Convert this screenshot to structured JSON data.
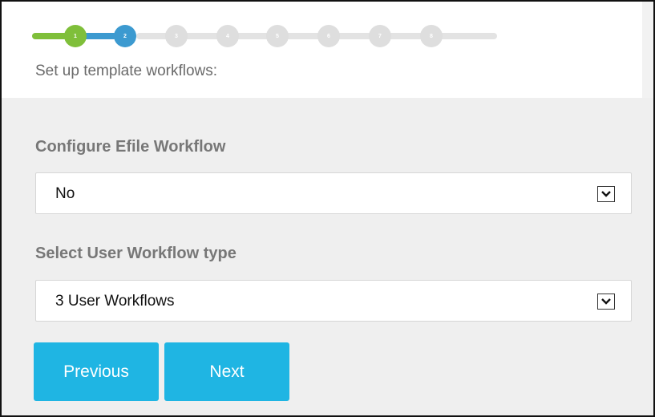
{
  "wizard": {
    "steps": [
      {
        "number": "1",
        "state": "done"
      },
      {
        "number": "2",
        "state": "current"
      },
      {
        "number": "3",
        "state": "pending"
      },
      {
        "number": "4",
        "state": "pending"
      },
      {
        "number": "5",
        "state": "pending"
      },
      {
        "number": "6",
        "state": "pending"
      },
      {
        "number": "7",
        "state": "pending"
      },
      {
        "number": "8",
        "state": "pending"
      }
    ],
    "subtitle": "Set up template workflows:"
  },
  "form": {
    "efile": {
      "label": "Configure Efile Workflow",
      "value": "No"
    },
    "user_workflow": {
      "label": "Select User Workflow type",
      "value": "3 User Workflows"
    }
  },
  "buttons": {
    "previous": "Previous",
    "next": "Next"
  },
  "colors": {
    "step_done": "#7fbf3a",
    "step_current": "#3c9ad0",
    "step_pending": "#dedede",
    "button": "#1fb5e3"
  }
}
